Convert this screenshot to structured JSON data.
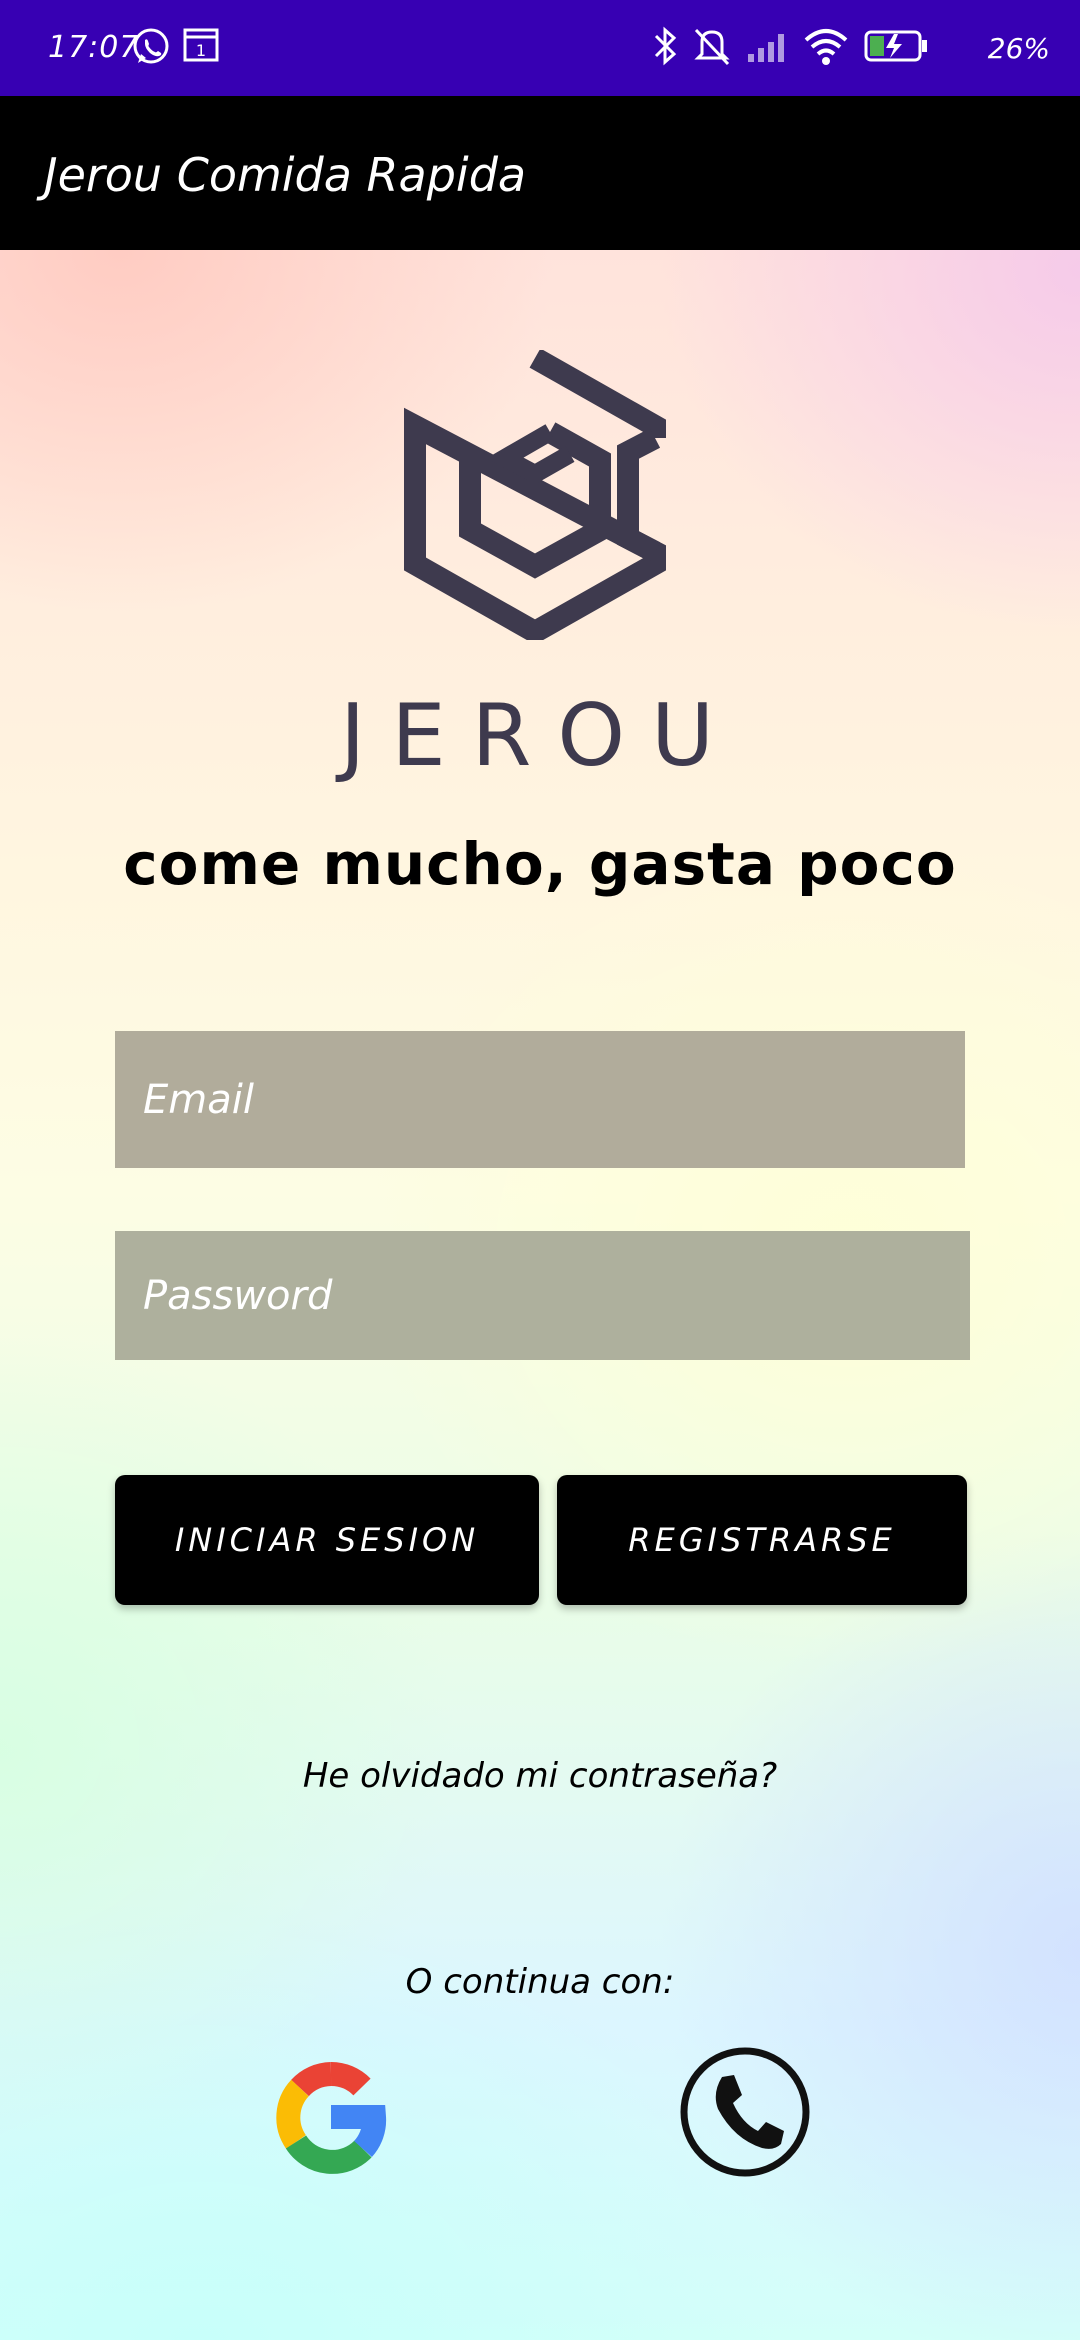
{
  "status_bar": {
    "time": "17:07",
    "left_icons": [
      "whatsapp-icon",
      "calendar-icon"
    ],
    "calendar_day": "1",
    "right_icons": [
      "bluetooth-icon",
      "mute-icon",
      "signal-icon",
      "wifi-icon",
      "battery-icon"
    ],
    "battery": "26%",
    "background": "#3700b3"
  },
  "app_bar": {
    "title": "Jerou Comida Rapida",
    "background": "#000000"
  },
  "brand": {
    "logo_icon": "hexagon-cube-logo",
    "wordmark": "JEROU",
    "slogan": "come mucho, gasta poco",
    "logo_color": "#3e3a4e"
  },
  "form": {
    "email_placeholder": "Email",
    "email_value": "",
    "password_placeholder": "Password",
    "password_value": ""
  },
  "buttons": {
    "login": "INICIAR SESION",
    "register": "REGISTRARSE"
  },
  "links": {
    "forgot_password": "He olvidado mi contraseña?",
    "continue_with": "O continua con:"
  },
  "social": {
    "google": "google-icon",
    "phone": "phone-icon"
  }
}
